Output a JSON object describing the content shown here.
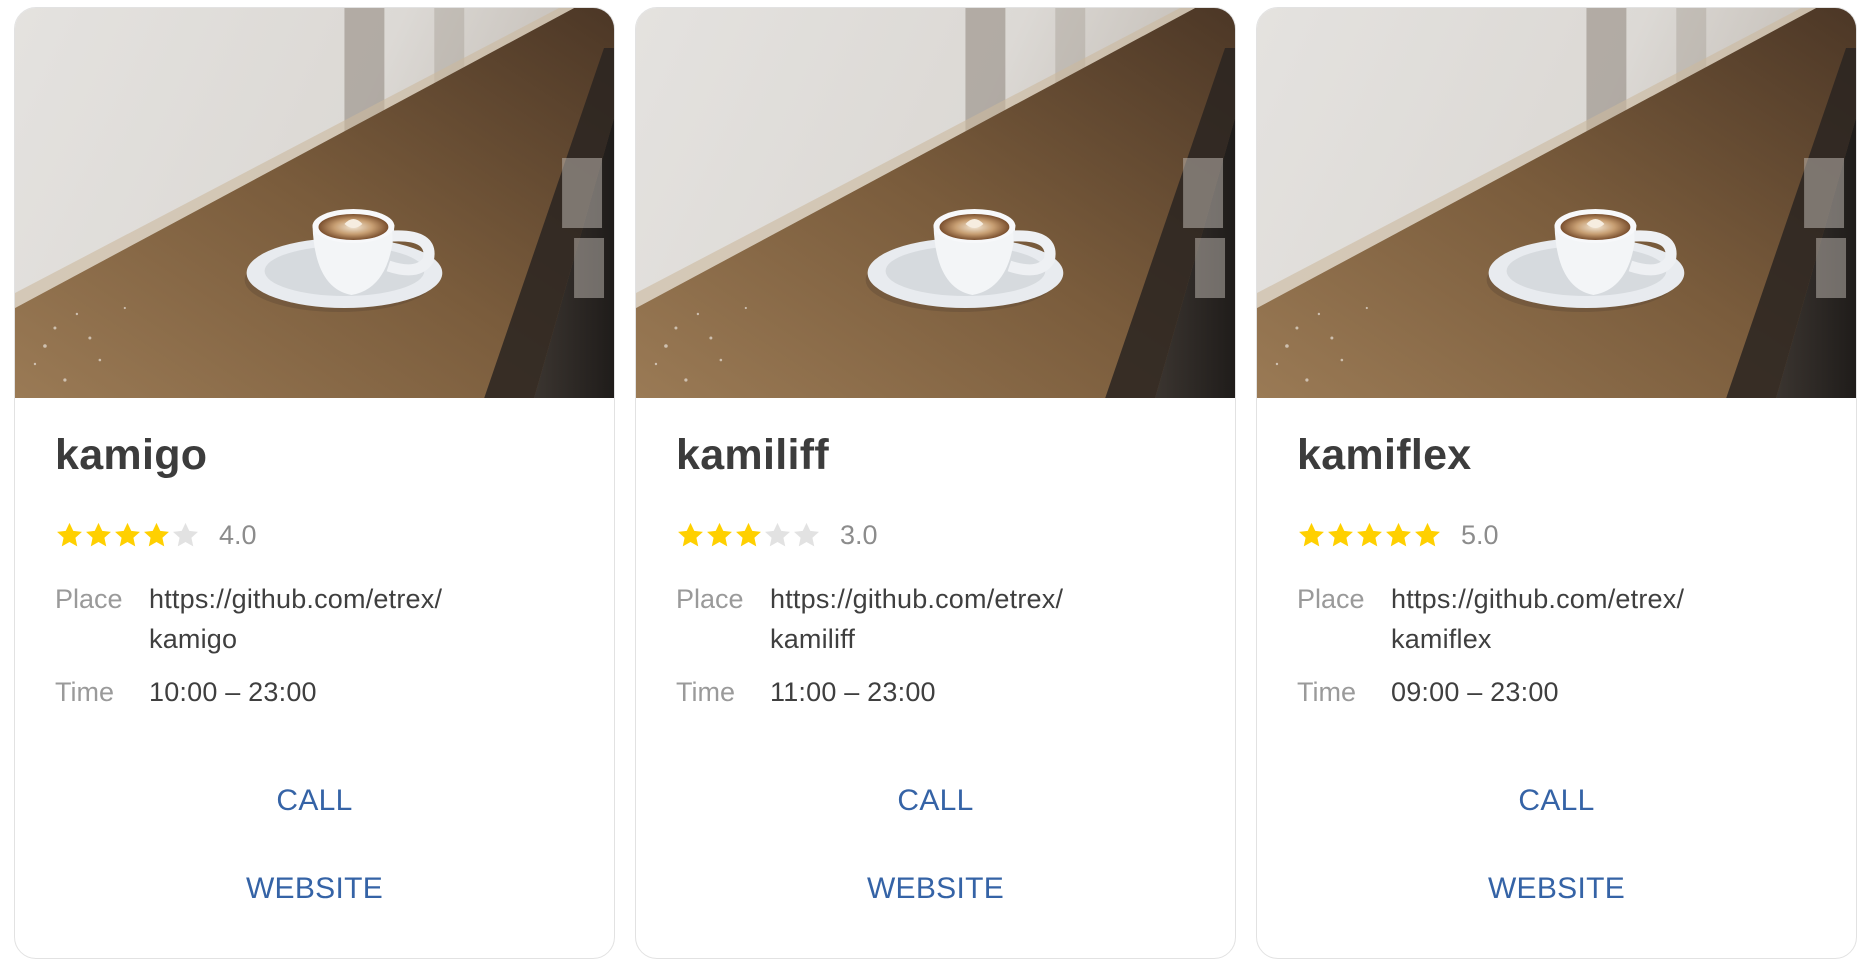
{
  "colors": {
    "star_filled": "#ffd000",
    "star_empty": "#e2e2e2",
    "action_text": "#3563a6",
    "title_text": "#3c3c3c",
    "label_text": "#9a9a9a",
    "border": "#e2e2e2"
  },
  "labels": {
    "place": "Place",
    "time": "Time",
    "call": "CALL",
    "website": "WEBSITE"
  },
  "cards": [
    {
      "title": "kamigo",
      "rating": 4,
      "rating_label": "4.0",
      "place_line1": "https://github.com/etrex/",
      "place_line2": "kamigo",
      "time": "10:00 – 23:00",
      "image": "coffee-cup-photo"
    },
    {
      "title": "kamiliff",
      "rating": 3,
      "rating_label": "3.0",
      "place_line1": "https://github.com/etrex/",
      "place_line2": "kamiliff",
      "time": "11:00 – 23:00",
      "image": "coffee-cup-photo"
    },
    {
      "title": "kamiflex",
      "rating": 5,
      "rating_label": "5.0",
      "place_line1": "https://github.com/etrex/",
      "place_line2": "kamiflex",
      "time": "09:00 – 23:00",
      "image": "coffee-cup-photo"
    }
  ]
}
